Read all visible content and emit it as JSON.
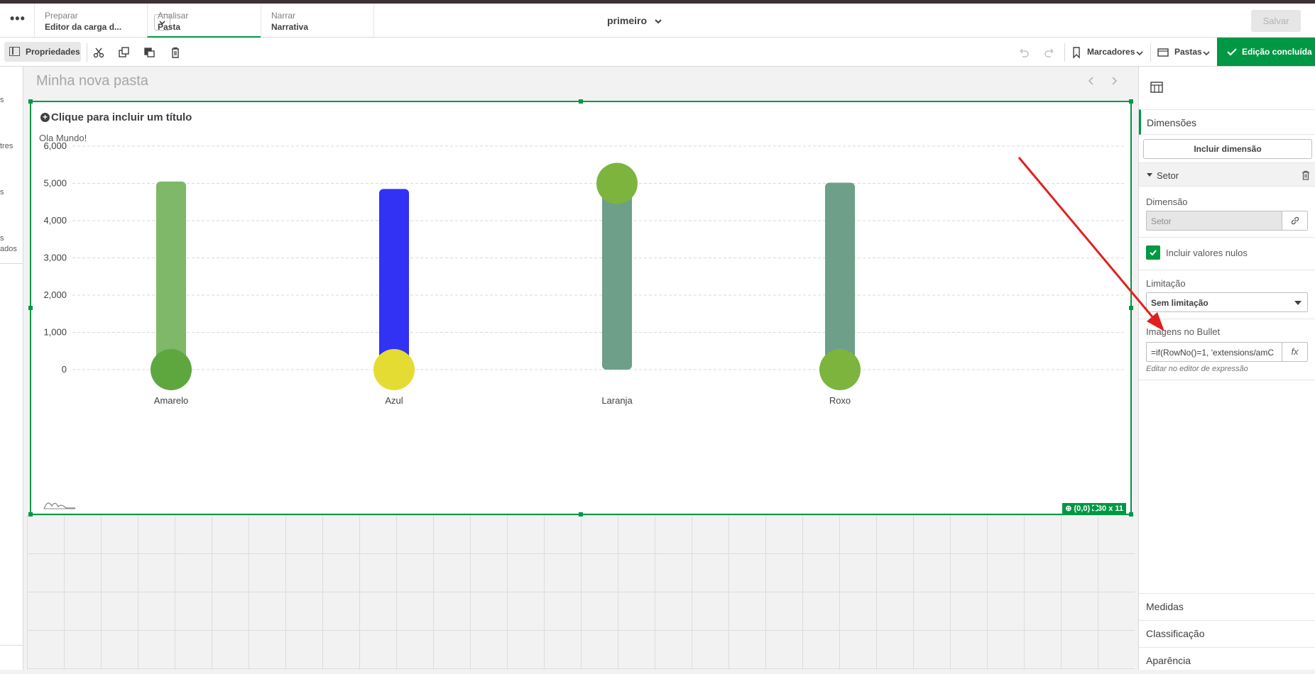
{
  "topnav": {
    "menu_label": "•••",
    "tabs": [
      {
        "line1": "Preparar",
        "line2": "Editor da carga d..."
      },
      {
        "line1": "Analisar",
        "line2": "Pasta"
      },
      {
        "line1": "Narrar",
        "line2": "Narrativa"
      }
    ],
    "app_title": "primeiro",
    "save_label": "Salvar"
  },
  "toolbar": {
    "properties_label": "Propriedades",
    "bookmarks_label": "Marcadores",
    "sheets_label": "Pastas",
    "done_label": "Edição concluída"
  },
  "leftstrip": {
    "fragments": [
      "s",
      "tres",
      "s",
      "s",
      "ados"
    ]
  },
  "sheet": {
    "title": "Minha nova pasta"
  },
  "chart": {
    "title_placeholder": "Clique para incluir um título",
    "subtitle": "Ola Mundo!",
    "position_badge": "(0,0)",
    "size_badge": "30 x 11",
    "colors": {
      "bar_green": "#7fb868",
      "bar_blue": "#3232f5",
      "bar_teal": "#6d9f89",
      "bullet_green": "#5ea73f",
      "bullet_yellow": "#e4dc33",
      "bullet_lightgreen": "#7db43e"
    }
  },
  "chart_data": {
    "type": "bar",
    "categories": [
      "Amarelo",
      "Azul",
      "Laranja",
      "Roxo"
    ],
    "values": [
      5050,
      4850,
      5000,
      5020
    ],
    "yticks": [
      "6,000",
      "5,000",
      "4,000",
      "3,000",
      "2,000",
      "1,000",
      "0"
    ],
    "ylim": [
      0,
      6000
    ],
    "grid": true,
    "xlabel": "",
    "ylabel": "",
    "bullet_position": [
      "bottom",
      "bottom",
      "top",
      "bottom"
    ],
    "bar_colors": [
      "#7fb868",
      "#3232f5",
      "#6d9f89",
      "#6d9f89"
    ],
    "bullet_colors": [
      "#5ea73f",
      "#e4dc33",
      "#7db43e",
      "#7db43e"
    ]
  },
  "rpanel": {
    "dimensions_label": "Dimensões",
    "add_dimension_label": "Incluir dimensão",
    "dimension_item": "Setor",
    "dimension_field_label": "Dimensão",
    "dimension_field_value": "Setor",
    "include_nulls_label": "Incluir valores nulos",
    "limitation_label": "Limitação",
    "limitation_value": "Sem limitação",
    "bullet_images_label": "Imagens no Bullet",
    "bullet_images_value": "=if(RowNo()=1, 'extensions/amC",
    "fx_label": "fx",
    "expression_hint": "Editar no editor de expressão",
    "measures_label": "Medidas",
    "sorting_label": "Classificação",
    "appearance_label": "Aparência"
  }
}
